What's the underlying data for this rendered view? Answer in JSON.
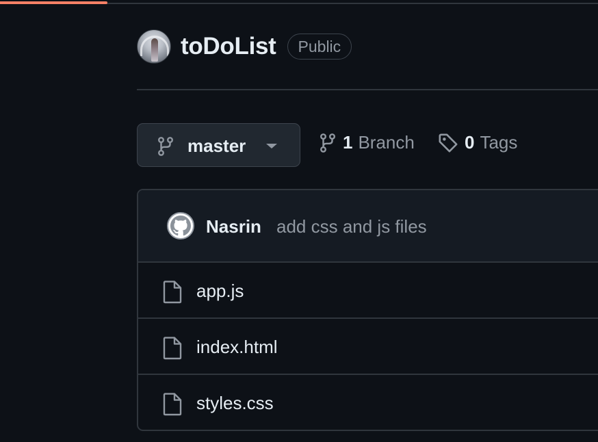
{
  "loading_progress": 0.18,
  "colors": {
    "background": "#0d1117",
    "accent_progress": "#f78166",
    "text_primary": "#e6edf3",
    "text_muted": "#9198a1",
    "border": "#30363d"
  },
  "repo": {
    "name": "toDoList",
    "visibility": "Public",
    "owner_avatar_icon": "user-avatar"
  },
  "branch_selector": {
    "current": "master",
    "icon": "git-branch-icon"
  },
  "branches": {
    "count": "1",
    "label": "Branch",
    "icon": "git-branch-icon"
  },
  "tags": {
    "count": "0",
    "label": "Tags",
    "icon": "tag-icon"
  },
  "latest_commit": {
    "author": "Nasrin",
    "message": "add css and js files",
    "avatar_icon": "github-mark-icon"
  },
  "files": [
    {
      "name": "app.js",
      "icon": "file-icon"
    },
    {
      "name": "index.html",
      "icon": "file-icon"
    },
    {
      "name": "styles.css",
      "icon": "file-icon"
    }
  ]
}
